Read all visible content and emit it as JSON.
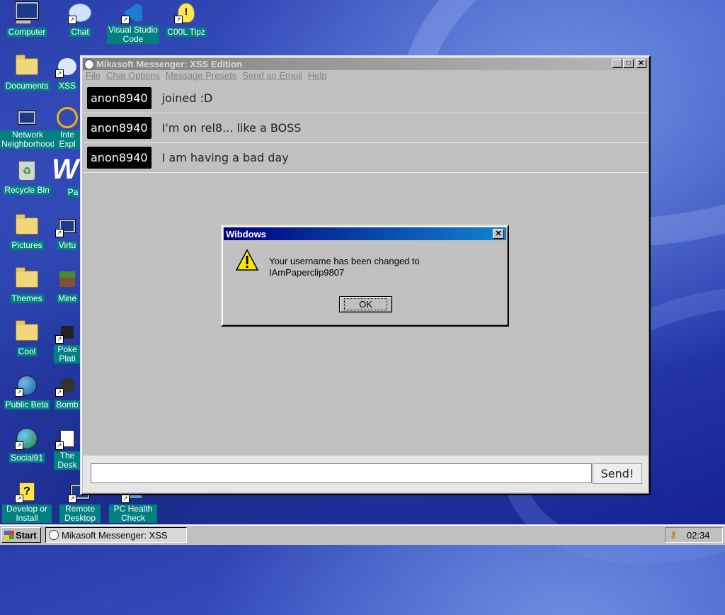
{
  "desktop": {
    "icons": [
      {
        "label": "Computer",
        "icon": "computer-icon"
      },
      {
        "label": "Chat",
        "icon": "chat-icon"
      },
      {
        "label": "Visual Studio Code",
        "icon": "vscode-icon"
      },
      {
        "label": "C00L Tipz",
        "icon": "tips-icon"
      },
      {
        "label": "Documents",
        "icon": "documents-folder-icon"
      },
      {
        "label": "XSS",
        "icon": "xss-icon"
      },
      {
        "label": "Network Neighborhood",
        "icon": "network-icon"
      },
      {
        "label": "Inte Expl",
        "icon": "internet-explorer-icon"
      },
      {
        "label": "Recycle Bin",
        "icon": "recycle-bin-icon"
      },
      {
        "label": "Pa",
        "icon": "paint-icon"
      },
      {
        "label": "Pictures",
        "icon": "folder-icon"
      },
      {
        "label": "Virtu",
        "icon": "virtual-icon"
      },
      {
        "label": "Themes",
        "icon": "folder-icon"
      },
      {
        "label": "Mine",
        "icon": "minecraft-icon"
      },
      {
        "label": "Cool",
        "icon": "folder-icon"
      },
      {
        "label": "Poke Plati",
        "icon": "pokemon-icon"
      },
      {
        "label": "Public Beta",
        "icon": "globe-icon"
      },
      {
        "label": "Bomb",
        "icon": "bomb-icon"
      },
      {
        "label": "Social91",
        "icon": "globe-icon"
      },
      {
        "label": "The Desk",
        "icon": "desktop-icon"
      },
      {
        "label": "Develop or Install",
        "icon": "develop-icon"
      },
      {
        "label": "Remote Desktop",
        "icon": "remote-desktop-icon"
      },
      {
        "label": "PC Health Check",
        "icon": "health-check-icon"
      }
    ]
  },
  "messenger": {
    "title": "Mikasoft Messenger: XSS Edition",
    "controls": {
      "minimize": "_",
      "maximize": "□",
      "close": "✕"
    },
    "menu": [
      "File",
      "Chat Options",
      "Message Presets",
      "Send an Emoji",
      "Help"
    ],
    "messages": [
      {
        "user": "anon8940",
        "text": "joined :D"
      },
      {
        "user": "anon8940",
        "text": "I'm on rel8... like a BOSS"
      },
      {
        "user": "anon8940",
        "text": "I am having a bad day"
      }
    ],
    "input": {
      "value": "",
      "placeholder": ""
    },
    "send_label": "Send!"
  },
  "dialog": {
    "title": "Wibdows",
    "close": "✕",
    "message_line1": "Your username has been changed to",
    "message_line2": "IAmPaperclip9807",
    "ok_label": "OK",
    "icon": "warning-icon"
  },
  "taskbar": {
    "start_label": "Start",
    "task_label": "Mikasoft Messenger: XSS",
    "clock": "02:34"
  },
  "colors": {
    "title_active": "#000080",
    "title_active_end": "#1084d0",
    "desktop_label_bg": "#008080",
    "face": "#c0c0c0"
  }
}
